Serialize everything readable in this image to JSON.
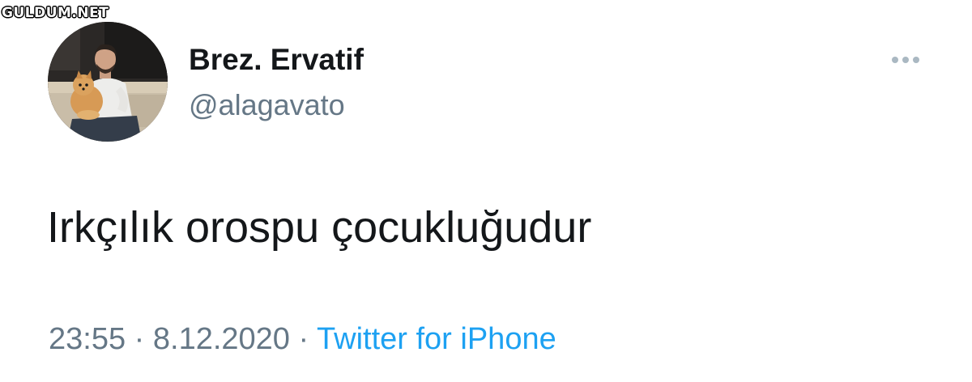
{
  "watermark": "GULDUM.NET",
  "tweet": {
    "author": {
      "display_name": "Brez. Ervatif",
      "handle": "@alagavato"
    },
    "text": "Irkçılık orospu çocukluğudur",
    "time": "23:55",
    "separator": "·",
    "date": "8.12.2020",
    "source": "Twitter for iPhone"
  },
  "colors": {
    "text_primary": "#14171a",
    "text_secondary": "#657786",
    "link": "#1da1f2",
    "more_dots": "#aab8c2"
  },
  "icons": {
    "more": "more-horizontal-icon"
  }
}
